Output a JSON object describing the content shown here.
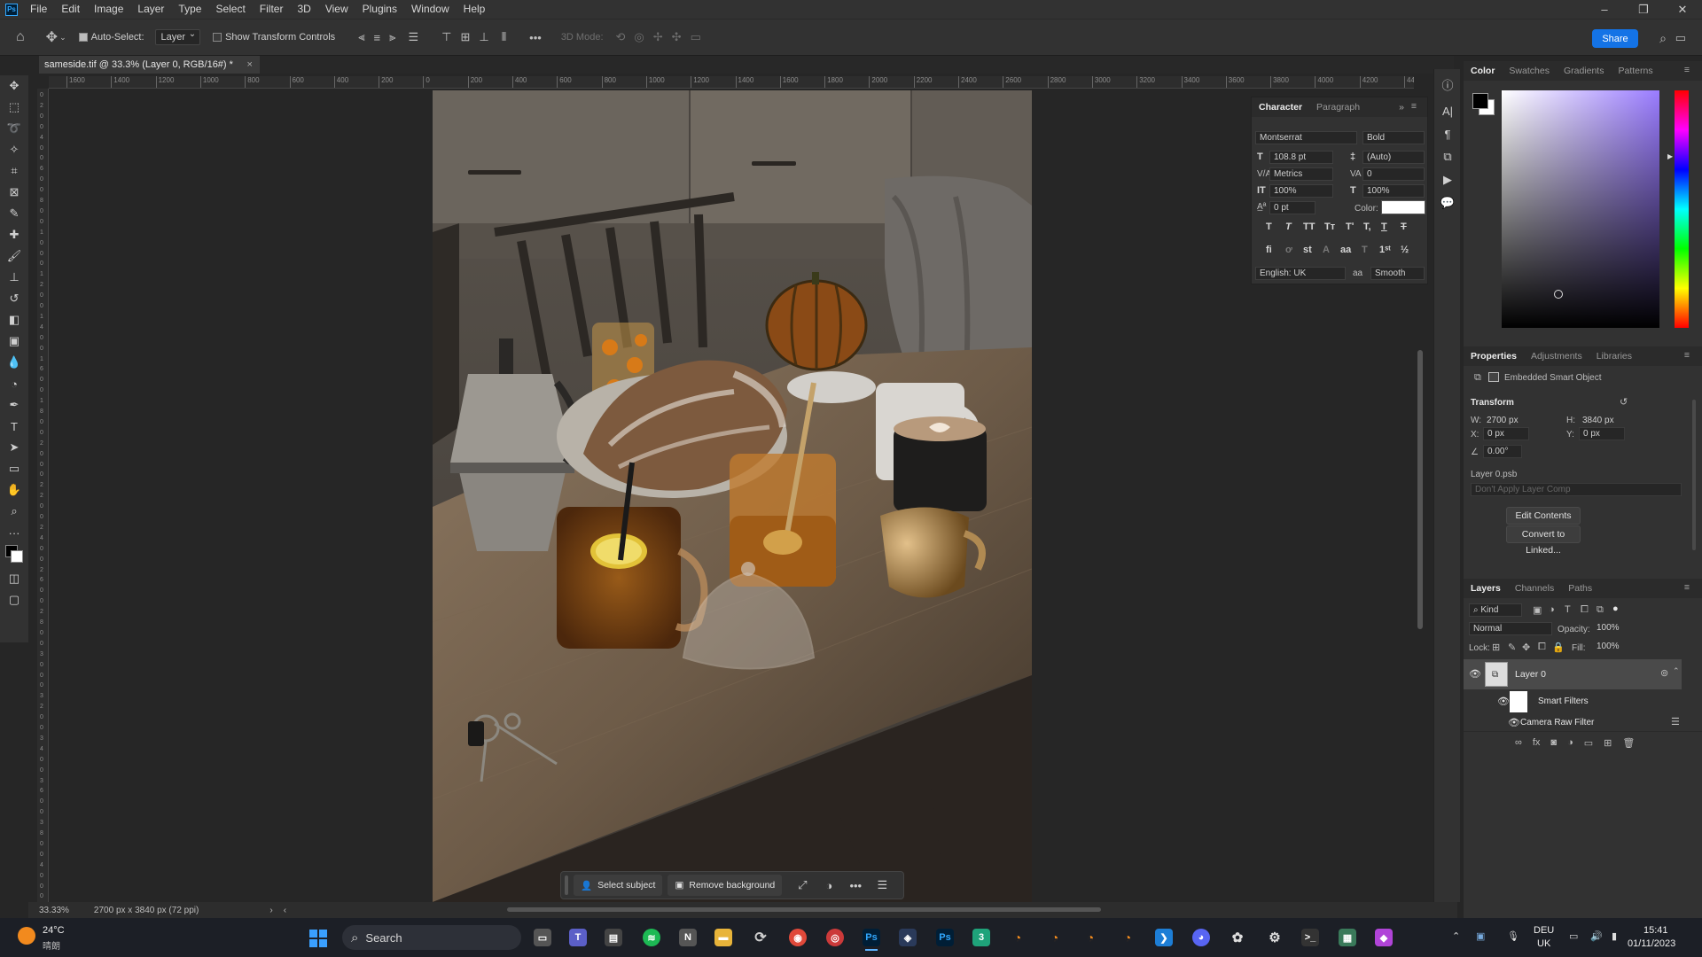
{
  "menubar": {
    "app_logo": "Ps",
    "items": [
      "File",
      "Edit",
      "Image",
      "Layer",
      "Type",
      "Select",
      "Filter",
      "3D",
      "View",
      "Plugins",
      "Window",
      "Help"
    ]
  },
  "options": {
    "auto_select_label": "Auto-Select:",
    "auto_select_target": "Layer",
    "transform_controls_label": "Show Transform Controls",
    "mode_3d_label": "3D Mode:",
    "share_label": "Share"
  },
  "document": {
    "tab_title": "sameside.tif @ 33.3% (Layer 0, RGB/16#) *"
  },
  "ruler": {
    "h_ticks": [
      "1600",
      "1400",
      "1200",
      "1000",
      "800",
      "600",
      "400",
      "200",
      "0",
      "200",
      "400",
      "600",
      "800",
      "1000",
      "1200",
      "1400",
      "1600",
      "1800",
      "2000",
      "2200",
      "2400",
      "2600",
      "2800",
      "3000",
      "3200",
      "3400",
      "3600",
      "3800",
      "4000",
      "4200",
      "44"
    ],
    "v_ticks": [
      "0",
      "2",
      "0",
      "0",
      "4",
      "0",
      "0",
      "6",
      "0",
      "0",
      "8",
      "0",
      "0",
      "1",
      "0",
      "0",
      "0",
      "1",
      "2",
      "0",
      "0",
      "1",
      "4",
      "0",
      "0",
      "1",
      "6",
      "0",
      "0",
      "1",
      "8",
      "0",
      "0",
      "2",
      "0",
      "0",
      "0",
      "2",
      "2",
      "0",
      "0",
      "2",
      "4",
      "0",
      "0",
      "2",
      "6",
      "0",
      "0",
      "2",
      "8",
      "0",
      "0",
      "3",
      "0",
      "0",
      "0",
      "3",
      "2",
      "0",
      "0",
      "3",
      "4",
      "0",
      "0",
      "3",
      "6",
      "0",
      "0",
      "3",
      "8",
      "0",
      "0",
      "4",
      "0",
      "0",
      "0"
    ]
  },
  "status": {
    "zoom": "33.33%",
    "doc_info": "2700 px x 3840 px (72 ppi)"
  },
  "context_bar": {
    "select_subject": "Select subject",
    "remove_background": "Remove background"
  },
  "character": {
    "tab_character": "Character",
    "tab_paragraph": "Paragraph",
    "font_family": "Montserrat",
    "font_style": "Bold",
    "font_size": "108.8 pt",
    "leading": "(Auto)",
    "kerning": "Metrics",
    "tracking": "0",
    "vertical_scale": "100%",
    "horizontal_scale": "100%",
    "baseline_shift": "0 pt",
    "color_label": "Color:",
    "color_value": "#ffffff",
    "language": "English: UK",
    "aa_label": "aa",
    "antialias": "Smooth"
  },
  "color_panel": {
    "tabs": [
      "Color",
      "Swatches",
      "Gradients",
      "Patterns"
    ]
  },
  "properties": {
    "tabs": [
      "Properties",
      "Adjustments",
      "Libraries"
    ],
    "kind": "Embedded Smart Object",
    "transform_label": "Transform",
    "w_label": "W:",
    "w_value": "2700 px",
    "h_label": "H:",
    "h_value": "3840 px",
    "x_label": "X:",
    "x_value": "0 px",
    "y_label": "Y:",
    "y_value": "0 px",
    "angle_value": "0.00°",
    "source_file": "Layer 0.psb",
    "layer_comp_placeholder": "Don't Apply Layer Comp",
    "edit_contents": "Edit Contents",
    "convert_linked": "Convert to Linked..."
  },
  "layers": {
    "tabs": [
      "Layers",
      "Channels",
      "Paths"
    ],
    "filter_kind": "Kind",
    "blend_mode": "Normal",
    "opacity_label": "Opacity:",
    "opacity_value": "100%",
    "lock_label": "Lock:",
    "fill_label": "Fill:",
    "fill_value": "100%",
    "rows": [
      {
        "name": "Layer 0"
      },
      {
        "name": "Smart Filters"
      },
      {
        "name": "Camera Raw Filter"
      }
    ]
  },
  "taskbar": {
    "weather_temp": "24°C",
    "weather_cond": "晴朗",
    "search_label": "Search",
    "lang_top": "DEU",
    "lang_bottom": "UK",
    "time": "15:41",
    "date": "01/11/2023"
  }
}
